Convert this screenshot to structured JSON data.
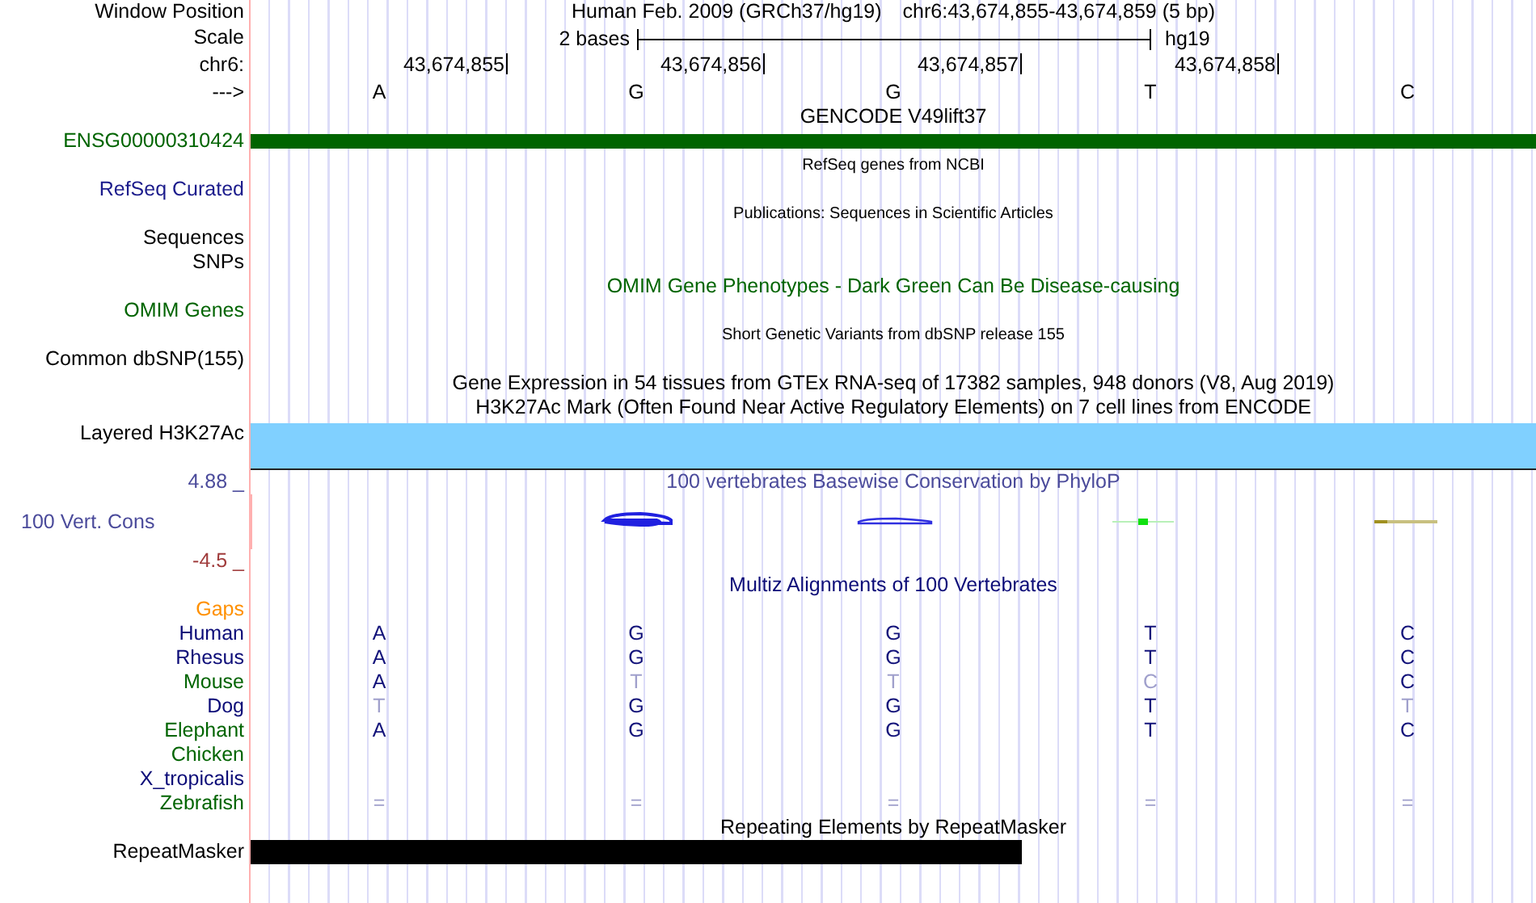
{
  "header": {
    "label": "Window Position",
    "assembly": "Human Feb. 2009 (GRCh37/hg19)",
    "position": "chr6:43,674,855-43,674,859 (5 bp)"
  },
  "scale": {
    "label": "Scale",
    "span": "2 bases",
    "assembly": "hg19"
  },
  "ruler": {
    "label": "chr6:",
    "ticks": [
      "43,674,855",
      "43,674,856",
      "43,674,857",
      "43,674,858"
    ]
  },
  "bases": {
    "label": "--->",
    "letters": [
      "A",
      "G",
      "G",
      "T",
      "C"
    ]
  },
  "rows": [
    {
      "kind": "title",
      "text": "GENCODE V49lift37",
      "color": "#000000"
    },
    {
      "kind": "gene",
      "label": "ENSG00000310424",
      "color": "#006400"
    },
    {
      "kind": "note",
      "text": "RefSeq genes from NCBI"
    },
    {
      "kind": "label",
      "label": "RefSeq Curated",
      "color": "#1c1c8c"
    },
    {
      "kind": "note",
      "text": "Publications: Sequences in Scientific Articles"
    },
    {
      "kind": "label",
      "label": "Sequences",
      "color": "#000000"
    },
    {
      "kind": "label",
      "label": "SNPs",
      "color": "#000000"
    },
    {
      "kind": "title",
      "text": "OMIM Gene Phenotypes - Dark Green Can Be Disease-causing",
      "color": "#006400"
    },
    {
      "kind": "label",
      "label": "OMIM Genes",
      "color": "#006400"
    },
    {
      "kind": "note",
      "text": "Short Genetic Variants from dbSNP release 155"
    },
    {
      "kind": "label",
      "label": "Common dbSNP(155)",
      "color": "#000000"
    },
    {
      "kind": "title",
      "text": "Gene Expression in 54 tissues from GTEx RNA-seq of 17382 samples, 948 donors (V8, Aug 2019)",
      "color": "#000000"
    },
    {
      "kind": "title",
      "text": "H3K27Ac Mark (Often Found Near Active Regulatory Elements) on 7 cell lines from ENCODE",
      "color": "#000000"
    },
    {
      "kind": "band",
      "label": "Layered H3K27Ac",
      "color": "#80d0ff"
    },
    {
      "kind": "scale-top",
      "label": "4.88 _",
      "text": "100 vertebrates Basewise Conservation by PhyloP",
      "color": "#4b4b9b"
    },
    {
      "kind": "wiggle",
      "label": "100 Vert. Cons",
      "color": "#4b4b9b"
    },
    {
      "kind": "scale-bottom",
      "label": "-4.5 _",
      "color": "#a03c3c"
    },
    {
      "kind": "title",
      "text": "Multiz Alignments of 100 Vertebrates",
      "color": "#0c0c78"
    },
    {
      "kind": "label",
      "label": "Gaps",
      "color": "#ff9000"
    },
    {
      "kind": "align",
      "label": "Human",
      "color": "#0c0c78",
      "bases": [
        {
          "letter": "A",
          "match": true
        },
        {
          "letter": "G",
          "match": true
        },
        {
          "letter": "G",
          "match": true
        },
        {
          "letter": "T",
          "match": true
        },
        {
          "letter": "C",
          "match": true
        }
      ]
    },
    {
      "kind": "align",
      "label": "Rhesus",
      "color": "#0c0c78",
      "bases": [
        {
          "letter": "A",
          "match": true
        },
        {
          "letter": "G",
          "match": true
        },
        {
          "letter": "G",
          "match": true
        },
        {
          "letter": "T",
          "match": true
        },
        {
          "letter": "C",
          "match": true
        }
      ]
    },
    {
      "kind": "align",
      "label": "Mouse",
      "color": "#006400",
      "bases": [
        {
          "letter": "A",
          "match": true
        },
        {
          "letter": "T",
          "match": false
        },
        {
          "letter": "T",
          "match": false
        },
        {
          "letter": "C",
          "match": false
        },
        {
          "letter": "C",
          "match": true
        }
      ]
    },
    {
      "kind": "align",
      "label": "Dog",
      "color": "#0c0c78",
      "bases": [
        {
          "letter": "T",
          "match": false
        },
        {
          "letter": "G",
          "match": true
        },
        {
          "letter": "G",
          "match": true
        },
        {
          "letter": "T",
          "match": true
        },
        {
          "letter": "T",
          "match": false
        }
      ]
    },
    {
      "kind": "align",
      "label": "Elephant",
      "color": "#006400",
      "bases": [
        {
          "letter": "A",
          "match": true
        },
        {
          "letter": "G",
          "match": true
        },
        {
          "letter": "G",
          "match": true
        },
        {
          "letter": "T",
          "match": true
        },
        {
          "letter": "C",
          "match": true
        }
      ]
    },
    {
      "kind": "label",
      "label": "Chicken",
      "color": "#006400"
    },
    {
      "kind": "label",
      "label": "X_tropicalis",
      "color": "#0c0c78"
    },
    {
      "kind": "align",
      "label": "Zebrafish",
      "color": "#006400",
      "bases": [
        {
          "letter": "=",
          "match": false
        },
        {
          "letter": "=",
          "match": false
        },
        {
          "letter": "=",
          "match": false
        },
        {
          "letter": "=",
          "match": false
        },
        {
          "letter": "=",
          "match": false
        }
      ]
    },
    {
      "kind": "title",
      "text": "Repeating Elements by RepeatMasker",
      "color": "#000000"
    },
    {
      "kind": "repeat",
      "label": "RepeatMasker"
    }
  ]
}
